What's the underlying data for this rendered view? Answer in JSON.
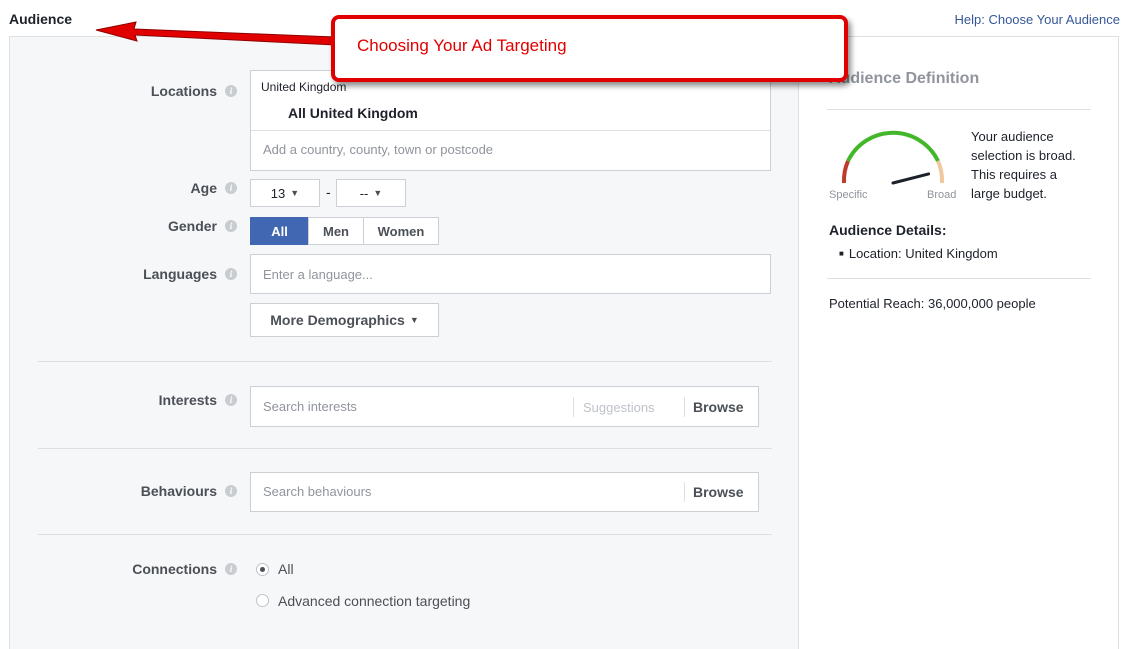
{
  "header": {
    "title": "Audience",
    "help_link": "Help: Choose Your Audience"
  },
  "callout": {
    "text": "Choosing Your Ad Targeting"
  },
  "form": {
    "locations": {
      "label": "Locations",
      "chip_header": "United Kingdom",
      "selected": "All United Kingdom",
      "placeholder": "Add a country, county, town or postcode"
    },
    "age": {
      "label": "Age",
      "min": "13",
      "separator": "-",
      "max": "--"
    },
    "gender": {
      "label": "Gender",
      "options": [
        "All",
        "Men",
        "Women"
      ],
      "selected": "All"
    },
    "languages": {
      "label": "Languages",
      "placeholder": "Enter a language..."
    },
    "more_demographics": "More Demographics",
    "interests": {
      "label": "Interests",
      "placeholder": "Search interests",
      "suggestions": "Suggestions",
      "browse": "Browse"
    },
    "behaviours": {
      "label": "Behaviours",
      "placeholder": "Search behaviours",
      "browse": "Browse"
    },
    "connections": {
      "label": "Connections",
      "options": [
        "All",
        "Advanced connection targeting"
      ],
      "selected": "All"
    }
  },
  "definition": {
    "title": "Audience Definition",
    "gauge_specific": "Specific",
    "gauge_broad": "Broad",
    "gauge_level": 0.85,
    "message": [
      "Your audience",
      "selection is broad.",
      "This requires a",
      "large budget."
    ],
    "details_title": "Audience Details:",
    "details": [
      "Location: United Kingdom"
    ],
    "potential_reach": "Potential Reach: 36,000,000 people"
  },
  "colors": {
    "accent": "#4267b2",
    "callout": "#e10000",
    "link": "#365899"
  }
}
